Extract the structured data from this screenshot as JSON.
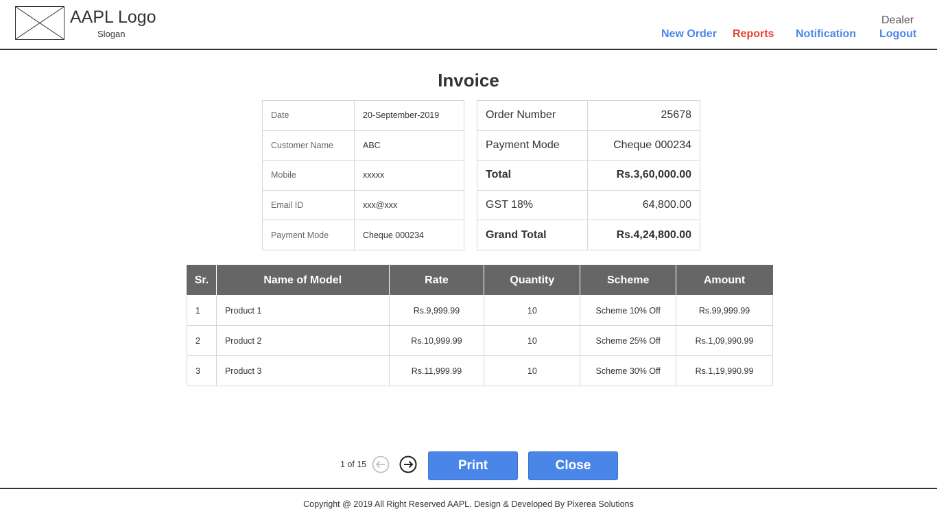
{
  "header": {
    "logo_title": "AAPL Logo",
    "logo_slogan": "Slogan",
    "logo_image": "image-placeholder-icon",
    "nav": {
      "new_order": "New Order",
      "reports": "Reports",
      "notification": "Notification",
      "dealer": "Dealer",
      "logout": "Logout"
    },
    "active_color": "#e8402f",
    "link_color": "#4a86e8"
  },
  "invoice": {
    "title": "Invoice",
    "customer": [
      {
        "label": "Date",
        "value": "20-September-2019"
      },
      {
        "label": "Customer Name",
        "value": "ABC"
      },
      {
        "label": "Mobile",
        "value": "xxxxx"
      },
      {
        "label": "Email ID",
        "value": "xxx@xxx"
      },
      {
        "label": "Payment Mode",
        "value": "Cheque 000234"
      }
    ],
    "order": [
      {
        "label": "Order Number",
        "value": "25678"
      },
      {
        "label": "Payment Mode",
        "value": "Cheque 000234"
      },
      {
        "label": "Total",
        "value": "Rs.3,60,000.00"
      },
      {
        "label": "GST 18%",
        "value": "64,800.00"
      },
      {
        "label": "Grand Total",
        "value": "Rs.4,24,800.00"
      }
    ]
  },
  "products": {
    "headers": [
      "Sr.",
      "Name of Model",
      "Rate",
      "Quantity",
      "Scheme",
      "Amount"
    ],
    "rows": [
      [
        "1",
        "Product 1",
        "Rs.9,999.99",
        "10",
        "Scheme 10% Off",
        "Rs.99,999.99"
      ],
      [
        "2",
        "Product 2",
        "Rs.10,999.99",
        "10",
        "Scheme 25% Off",
        "Rs.1,09,990.99"
      ],
      [
        "3",
        "Product 3",
        "Rs.11,999.99",
        "10",
        "Scheme 30% Off",
        "Rs.1,19,990.99"
      ]
    ],
    "header_bg": "#666666"
  },
  "pagination": {
    "info": "1 of 15",
    "prev_icon": "arrow-left-circle-icon",
    "next_icon": "arrow-right-circle-icon"
  },
  "actions": {
    "print": "Print",
    "close": "Close",
    "button_color": "#4a86e8"
  },
  "footer": {
    "copyright": "Copyright @ 2019 All Right Reserved AAPL. Design & Developed By Pixerea Solutions"
  }
}
